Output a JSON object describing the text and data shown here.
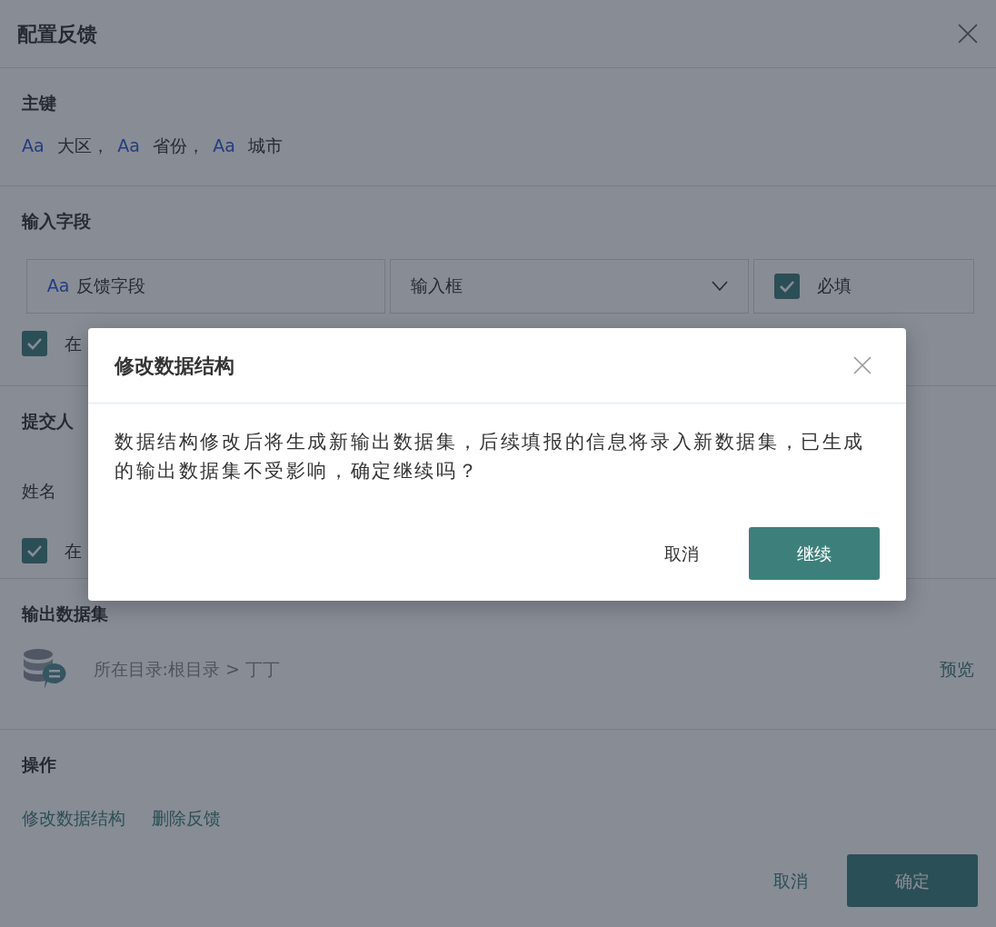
{
  "panel": {
    "title": "配置反馈"
  },
  "primary_key": {
    "heading": "主键",
    "fields": [
      {
        "badge": "Aa",
        "name": "大区，"
      },
      {
        "badge": "Aa",
        "name": "省份，"
      },
      {
        "badge": "Aa",
        "name": "城市"
      }
    ]
  },
  "input_fields": {
    "heading": "输入字段",
    "field": {
      "badge": "Aa",
      "name": "反馈字段"
    },
    "control": {
      "value": "输入框"
    },
    "required": {
      "label": "必填",
      "checked": true
    },
    "option": {
      "label": "在",
      "checked": true
    }
  },
  "submitter": {
    "heading": "提交人",
    "name_label": "姓名",
    "option": {
      "label": "在",
      "checked": true
    }
  },
  "output_dataset": {
    "heading": "输出数据集",
    "path": "所在目录:根目录 > 丁丁",
    "preview": "预览"
  },
  "actions": {
    "heading": "操作",
    "links": [
      "修改数据结构",
      "删除反馈"
    ]
  },
  "footer": {
    "cancel": "取消",
    "confirm": "确定"
  },
  "confirm_dialog": {
    "title": "修改数据结构",
    "message": "数据结构修改后将生成新输出数据集，后续填报的信息将录入新数据集，已生成的输出数据集不受影响，确定继续吗？",
    "cancel": "取消",
    "continue": "继续"
  }
}
